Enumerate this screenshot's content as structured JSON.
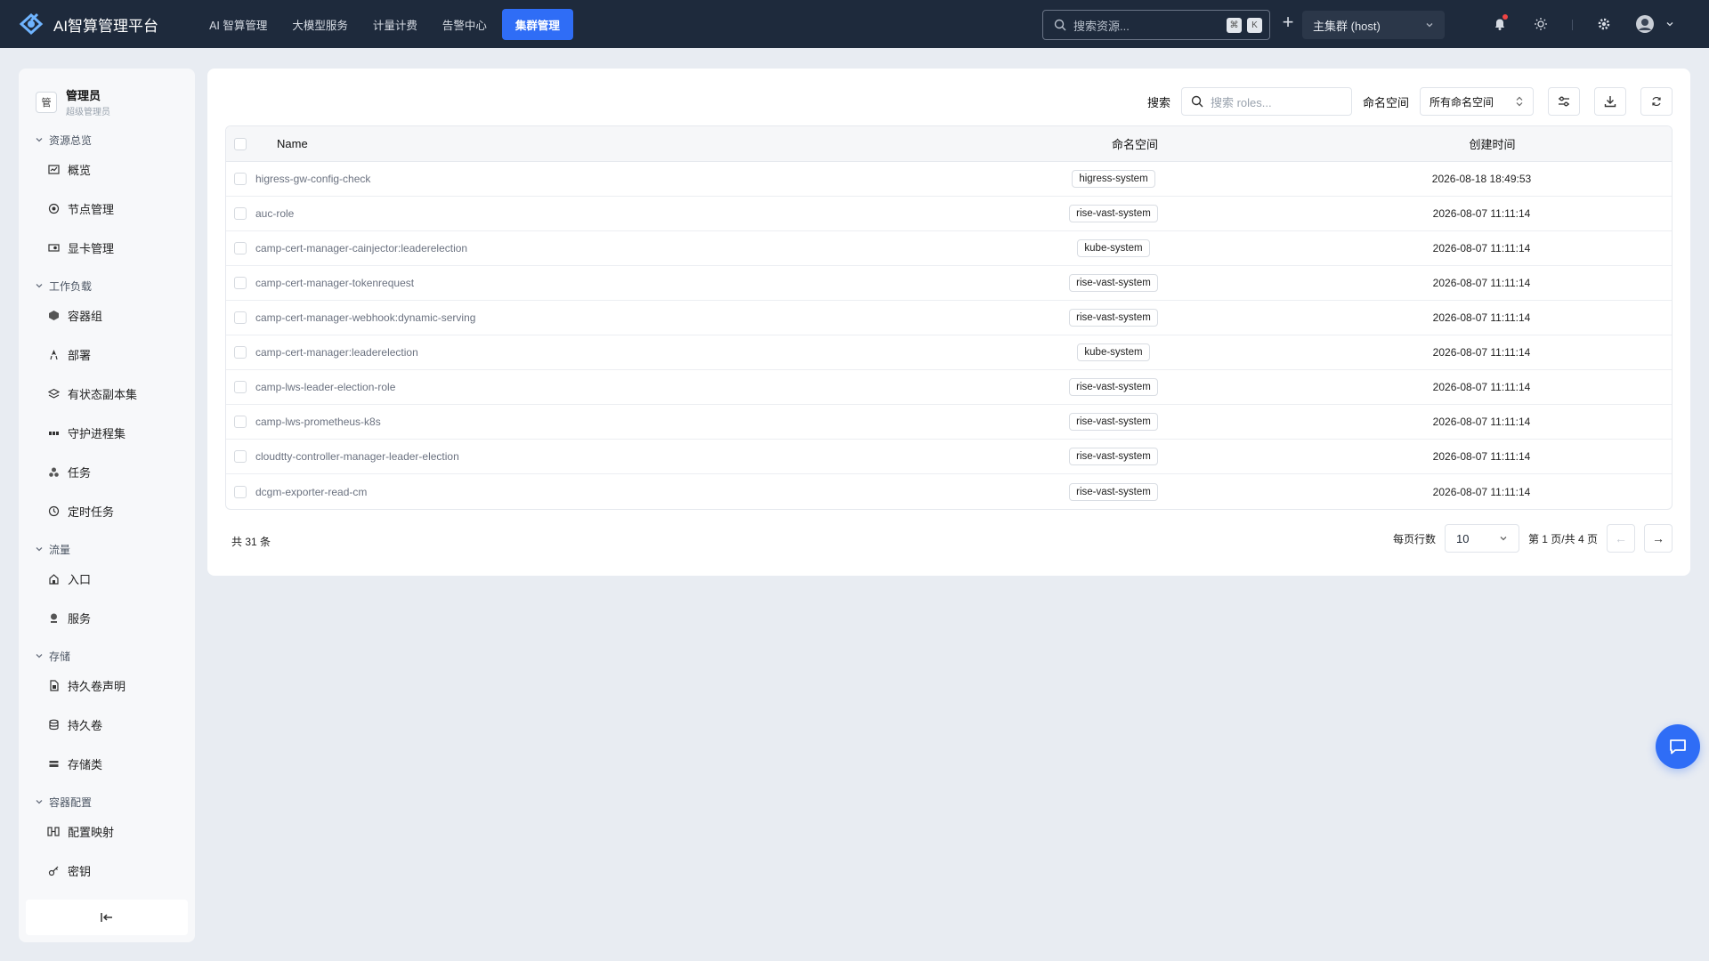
{
  "app": {
    "title": "AI智算管理平台"
  },
  "topnav": [
    {
      "label": "AI 智算管理",
      "active": false
    },
    {
      "label": "大模型服务",
      "active": false
    },
    {
      "label": "计量计费",
      "active": false
    },
    {
      "label": "告警中心",
      "active": false
    },
    {
      "label": "集群管理",
      "active": true
    }
  ],
  "search": {
    "placeholder": "搜索资源...",
    "kbd1": "⌘",
    "kbd2": "K"
  },
  "cluster": {
    "selected": "主集群 (host)"
  },
  "user": {
    "avatar_text": "管",
    "name": "管理员",
    "role": "超级管理员"
  },
  "sidebar": {
    "groups": [
      {
        "label": "资源总览",
        "items": [
          {
            "label": "概览",
            "icon": "dashboard-icon"
          },
          {
            "label": "节点管理",
            "icon": "node-icon"
          },
          {
            "label": "显卡管理",
            "icon": "gpu-icon"
          }
        ]
      },
      {
        "label": "工作负载",
        "items": [
          {
            "label": "容器组",
            "icon": "pod-icon"
          },
          {
            "label": "部署",
            "icon": "deploy-icon"
          },
          {
            "label": "有状态副本集",
            "icon": "statefulset-icon"
          },
          {
            "label": "守护进程集",
            "icon": "daemonset-icon"
          },
          {
            "label": "任务",
            "icon": "job-icon"
          },
          {
            "label": "定时任务",
            "icon": "cronjob-icon"
          }
        ]
      },
      {
        "label": "流量",
        "items": [
          {
            "label": "入口",
            "icon": "ingress-icon"
          },
          {
            "label": "服务",
            "icon": "service-icon"
          }
        ]
      },
      {
        "label": "存储",
        "items": [
          {
            "label": "持久卷声明",
            "icon": "pvc-icon"
          },
          {
            "label": "持久卷",
            "icon": "pv-icon"
          },
          {
            "label": "存储类",
            "icon": "storageclass-icon"
          }
        ]
      },
      {
        "label": "容器配置",
        "items": [
          {
            "label": "配置映射",
            "icon": "configmap-icon"
          },
          {
            "label": "密钥",
            "icon": "secret-icon"
          }
        ]
      }
    ]
  },
  "toolbar": {
    "search_label": "搜索",
    "search_placeholder": "搜索 roles...",
    "namespace_label": "命名空间",
    "namespace_value": "所有命名空间"
  },
  "table": {
    "headers": {
      "name": "Name",
      "namespace": "命名空间",
      "created": "创建时间"
    },
    "rows": [
      {
        "name": "higress-gw-config-check",
        "namespace": "higress-system",
        "created": "2026-08-18 18:49:53"
      },
      {
        "name": "auc-role",
        "namespace": "rise-vast-system",
        "created": "2026-08-07 11:11:14"
      },
      {
        "name": "camp-cert-manager-cainjector:leaderelection",
        "namespace": "kube-system",
        "created": "2026-08-07 11:11:14"
      },
      {
        "name": "camp-cert-manager-tokenrequest",
        "namespace": "rise-vast-system",
        "created": "2026-08-07 11:11:14"
      },
      {
        "name": "camp-cert-manager-webhook:dynamic-serving",
        "namespace": "rise-vast-system",
        "created": "2026-08-07 11:11:14"
      },
      {
        "name": "camp-cert-manager:leaderelection",
        "namespace": "kube-system",
        "created": "2026-08-07 11:11:14"
      },
      {
        "name": "camp-lws-leader-election-role",
        "namespace": "rise-vast-system",
        "created": "2026-08-07 11:11:14"
      },
      {
        "name": "camp-lws-prometheus-k8s",
        "namespace": "rise-vast-system",
        "created": "2026-08-07 11:11:14"
      },
      {
        "name": "cloudtty-controller-manager-leader-election",
        "namespace": "rise-vast-system",
        "created": "2026-08-07 11:11:14"
      },
      {
        "name": "dcgm-exporter-read-cm",
        "namespace": "rise-vast-system",
        "created": "2026-08-07 11:11:14"
      }
    ]
  },
  "pagination": {
    "total": "共 31 条",
    "rows_label": "每页行数",
    "rows_value": "10",
    "page_info": "第 1 页/共 4 页",
    "prev": "←",
    "next": "→"
  },
  "colors": {
    "accent": "#2f6df6",
    "topbar": "#1e2a3c",
    "notification": "#ef4444"
  }
}
